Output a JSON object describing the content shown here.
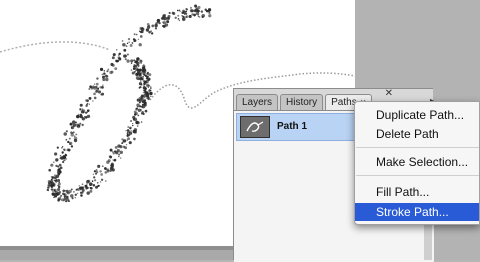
{
  "panel": {
    "tabs": [
      "Layers",
      "History",
      "Paths"
    ],
    "tab_close_glyph": "✕",
    "close_glyph": "✕",
    "path_item_label": "Path 1"
  },
  "context_menu": {
    "items": [
      {
        "label": "Duplicate Path..."
      },
      {
        "label": "Delete Path"
      },
      {
        "label": "Make Selection..."
      },
      {
        "label": "Fill Path..."
      },
      {
        "label": "Stroke Path..."
      }
    ],
    "selected_index": 4
  },
  "colors": {
    "selection_blue": "#2a5bd7",
    "row_highlight": "#b9d3f4",
    "canvas_white": "#ffffff",
    "stroke_dark": "#2a2a2a"
  },
  "icons": {
    "path_thumbnail": "pen-path-thumbnail-icon",
    "close": "close-icon",
    "panel_menu": "panel-menu-arrow-icon"
  }
}
